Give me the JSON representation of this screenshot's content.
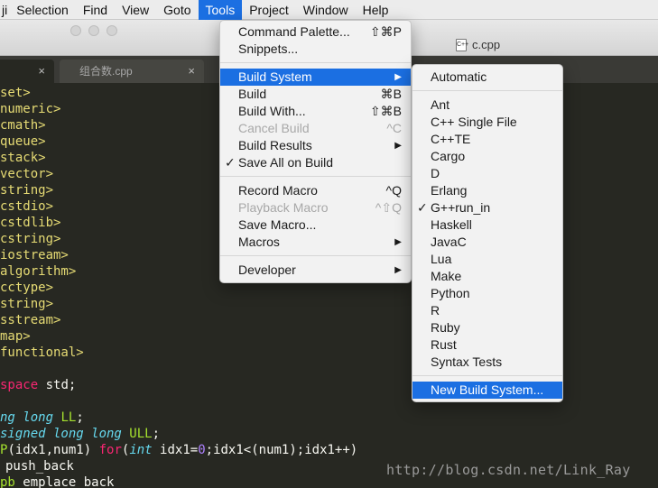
{
  "menubar": {
    "items": [
      "ji",
      "Selection",
      "Find",
      "View",
      "Goto",
      "Tools",
      "Project",
      "Window",
      "Help"
    ],
    "active": "Tools"
  },
  "window": {
    "title": "c.cpp",
    "file_icon": "cpp-file-icon"
  },
  "tabs": [
    {
      "label": ""
    },
    {
      "label": "组合数.cpp"
    }
  ],
  "tools_menu": {
    "items": [
      {
        "label": "Command Palette...",
        "shortcut": "⇧⌘P"
      },
      {
        "label": "Snippets..."
      },
      {
        "label": "Build System",
        "submenu": true,
        "highlighted": true
      },
      {
        "label": "Build",
        "shortcut": "⌘B"
      },
      {
        "label": "Build With...",
        "shortcut": "⇧⌘B"
      },
      {
        "label": "Cancel Build",
        "shortcut": "^C",
        "disabled": true
      },
      {
        "label": "Build Results",
        "submenu": true
      },
      {
        "label": "Save All on Build",
        "checked": true
      },
      {
        "label": "Record Macro",
        "shortcut": "^Q"
      },
      {
        "label": "Playback Macro",
        "shortcut": "^⇧Q",
        "disabled": true
      },
      {
        "label": "Save Macro..."
      },
      {
        "label": "Macros",
        "submenu": true
      },
      {
        "label": "Developer",
        "submenu": true
      }
    ]
  },
  "build_system_menu": {
    "items": [
      {
        "label": "Automatic"
      },
      {
        "label": "Ant"
      },
      {
        "label": "C++ Single File"
      },
      {
        "label": "C++TE"
      },
      {
        "label": "Cargo"
      },
      {
        "label": "D"
      },
      {
        "label": "Erlang"
      },
      {
        "label": "G++run_in",
        "checked": true
      },
      {
        "label": "Haskell"
      },
      {
        "label": "JavaC"
      },
      {
        "label": "Lua"
      },
      {
        "label": "Make"
      },
      {
        "label": "Python"
      },
      {
        "label": "R"
      },
      {
        "label": "Ruby"
      },
      {
        "label": "Rust"
      },
      {
        "label": "Syntax Tests"
      },
      {
        "label": "New Build System...",
        "highlighted": true
      }
    ]
  },
  "editor": {
    "includes": [
      "set>",
      "numeric>",
      "cmath>",
      "queue>",
      "stack>",
      "vector>",
      "string>",
      "cstdio>",
      "cstdlib>",
      "cstring>",
      "iostream>",
      "algorithm>",
      "cctype>",
      "string>",
      "sstream>",
      "map>",
      "functional>"
    ],
    "namespace_line": {
      "kw": "space",
      "rest": " std;"
    },
    "typedef_lines": [
      {
        "a": "ng",
        "b": " long",
        "c": " LL",
        "d": ";"
      },
      {
        "a": "signed",
        "b": " long long",
        "c": " ULL",
        "d": ";"
      }
    ],
    "define_line": {
      "a": "P",
      "b": "(idx1,num1) ",
      "c": "for",
      "d": "(",
      "e": "int",
      "f": " idx1=",
      "g": "0",
      "h": ";idx1<(num1);idx1++)"
    },
    "pb_lines": [
      "push_back",
      "emplace_back"
    ],
    "pb_prefixes": [
      "",
      "pb"
    ]
  },
  "watermark": "http://blog.csdn.net/Link_Ray"
}
